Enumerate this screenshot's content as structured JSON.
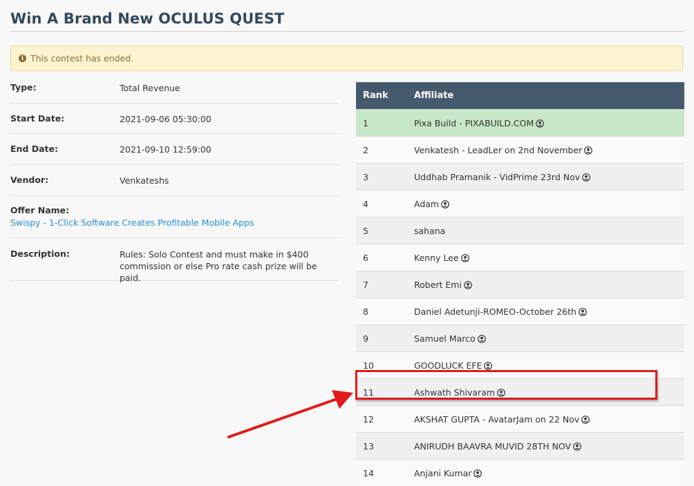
{
  "page": {
    "title": "Win A Brand New OCULUS QUEST",
    "alert": "This contest has ended."
  },
  "details": {
    "type_label": "Type:",
    "type_value": "Total Revenue",
    "start_label": "Start Date:",
    "start_value": "2021-09-06 05:30:00",
    "end_label": "End Date:",
    "end_value": "2021-09-10 12:59:00",
    "vendor_label": "Vendor:",
    "vendor_value": "Venkateshs",
    "offer_label": "Offer Name:",
    "offer_value": "Swispy - 1-Click Software Creates Profitable Mobile Apps",
    "description_label": "Description:",
    "description_value": "Rules: Solo Contest and must make in $400 commission or else Pro rate cash prize will be paid."
  },
  "leaderboard": {
    "headers": {
      "rank": "Rank",
      "affiliate": "Affiliate"
    },
    "rows": [
      {
        "rank": "1",
        "affiliate": "Pixa Build - PIXABUILD.COM",
        "icon": "user-circle-icon"
      },
      {
        "rank": "2",
        "affiliate": "Venkatesh - LeadLer on 2nd November",
        "icon": "user-circle-icon"
      },
      {
        "rank": "3",
        "affiliate": "Uddhab Pramanik - VidPrime 23rd Nov",
        "icon": "user-circle-icon"
      },
      {
        "rank": "4",
        "affiliate": "Adam",
        "icon": "user-circle-icon"
      },
      {
        "rank": "5",
        "affiliate": "sahana",
        "icon": ""
      },
      {
        "rank": "6",
        "affiliate": "Kenny Lee",
        "icon": "user-circle-icon"
      },
      {
        "rank": "7",
        "affiliate": "Robert Emi",
        "icon": "user-circle-icon"
      },
      {
        "rank": "8",
        "affiliate": "Daniel Adetunji-ROMEO-October 26th",
        "icon": "user-circle-icon"
      },
      {
        "rank": "9",
        "affiliate": "Samuel Marco",
        "icon": "user-circle-icon"
      },
      {
        "rank": "10",
        "affiliate": "GOODLUCK EFE",
        "icon": "user-circle-icon"
      },
      {
        "rank": "11",
        "affiliate": "Ashwath Shivaram",
        "icon": "user-circle-icon"
      },
      {
        "rank": "12",
        "affiliate": "AKSHAT GUPTA - AvatarJam on 22 Nov",
        "icon": "user-circle-icon"
      },
      {
        "rank": "13",
        "affiliate": "ANIRUDH BAAVRA MUVID 28TH NOV",
        "icon": "user-circle-icon"
      },
      {
        "rank": "14",
        "affiliate": "Anjani Kumar",
        "icon": "user-circle-icon"
      }
    ]
  },
  "annotation": {
    "highlight_color": "#e01b1b",
    "highlighted_rank": "11"
  },
  "colors": {
    "header_bg": "#465a6e",
    "first_place_bg": "#c7e8c7",
    "alert_bg": "#fcf4d0",
    "link": "#2a8fd8"
  }
}
